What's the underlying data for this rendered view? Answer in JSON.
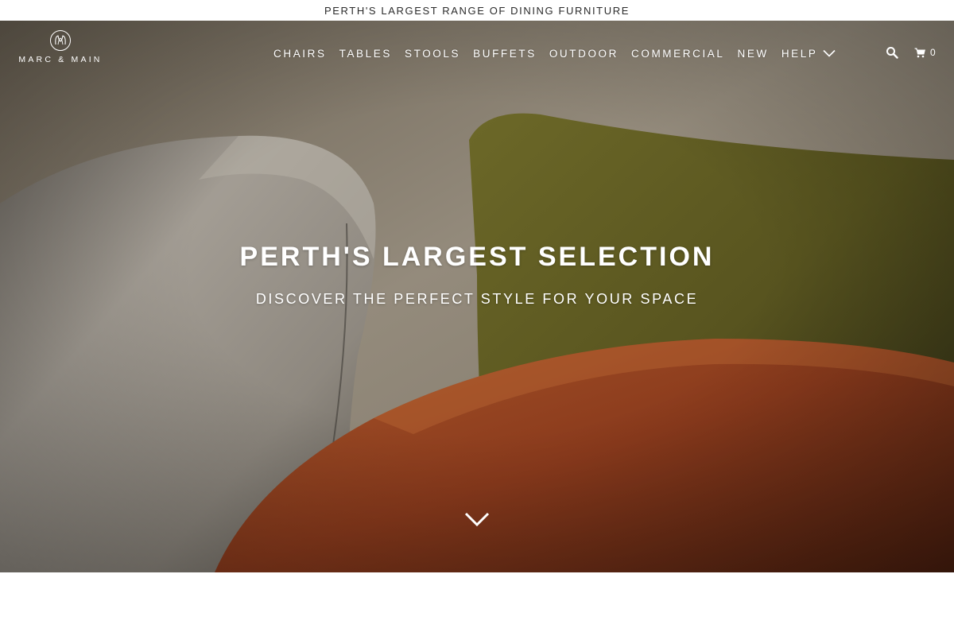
{
  "announcement": "PERTH'S LARGEST RANGE OF DINING FURNITURE",
  "brand": {
    "name": "MARC & MAIN",
    "logo_icon": "monogram-icon"
  },
  "nav": {
    "items": [
      {
        "label": "CHAIRS"
      },
      {
        "label": "TABLES"
      },
      {
        "label": "STOOLS"
      },
      {
        "label": "BUFFETS"
      },
      {
        "label": "OUTDOOR"
      },
      {
        "label": "COMMERCIAL"
      },
      {
        "label": "NEW"
      }
    ],
    "help_label": "HELP",
    "help_icon": "chevron-down-icon"
  },
  "tools": {
    "search_icon": "search-icon",
    "cart_icon": "cart-icon",
    "cart_count": "0"
  },
  "hero": {
    "title": "PERTH'S LARGEST SELECTION",
    "subtitle": "DISCOVER THE PERFECT STYLE FOR YOUR SPACE",
    "scroll_icon": "chevron-down-icon"
  },
  "colors": {
    "text_on_hero": "#ffffff",
    "announcement_bg": "#ffffff",
    "announcement_text": "#2b2b2b",
    "rust_chair": "#8a3a1c",
    "olive_chair": "#5e5a26",
    "grey_chair": "#9a9389"
  }
}
